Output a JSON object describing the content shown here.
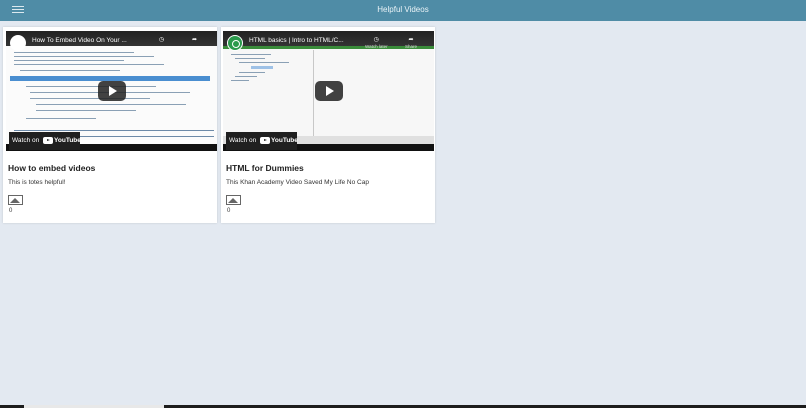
{
  "header": {
    "title": "Helpful Videos",
    "menu_icon": "hamburger-icon"
  },
  "videos": [
    {
      "player_title": "How To Embed Video On Your ...",
      "card_title": "How to embed videos",
      "description": "This is totes helpful!",
      "count": "0",
      "watch_on": "Watch on",
      "brand": "YouTube"
    },
    {
      "player_title": "HTML basics | Intro to HTML/C...",
      "card_title": "HTML for Dummies",
      "description": "This Khan Academy Video Saved My Life No Cap",
      "count": "0",
      "watch_on": "Watch on",
      "brand": "YouTube",
      "watch_later": "Watch later",
      "share": "Share"
    }
  ],
  "colors": {
    "topbar": "#4f8ca6",
    "background": "#e3e9f1"
  }
}
